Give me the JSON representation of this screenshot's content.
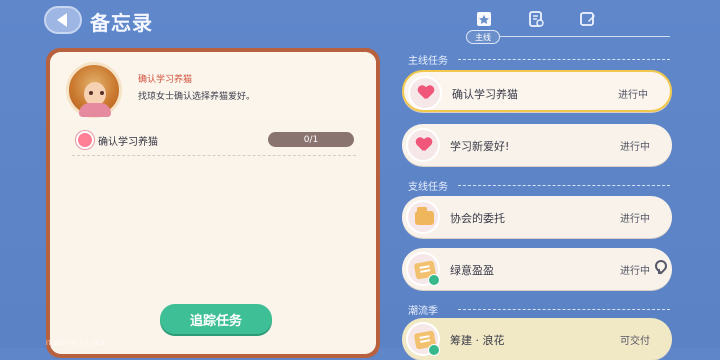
{
  "header": {
    "title": "备忘录",
    "tabs": [
      {
        "name": "main",
        "icon": "main-quest-icon"
      },
      {
        "name": "branch",
        "icon": "document-icon"
      },
      {
        "name": "edit",
        "icon": "edit-icon"
      }
    ],
    "active_tab_label": "主线"
  },
  "detail": {
    "npc_task_title": "确认学习养猫",
    "npc_task_desc": "找琼女士确认选择养猫爱好。",
    "task_label": "确认学习养猫",
    "progress_text": "0/1",
    "progress_value": 0,
    "track_button": "追踪任务",
    "debug": "IT 2022 TE 0.1.18.0"
  },
  "sections": {
    "main": "主线任务",
    "branch": "支线任务",
    "season": "潮流季"
  },
  "quests": [
    {
      "name": "确认学习养猫",
      "status": "进行中",
      "icon": "heart-icon",
      "selected": true
    },
    {
      "name": "学习新爱好!",
      "status": "进行中",
      "icon": "heart-icon",
      "selected": false
    },
    {
      "name": "协会的委托",
      "status": "进行中",
      "icon": "folder-icon",
      "selected": false
    },
    {
      "name": "绿意盈盈",
      "status": "进行中",
      "icon": "book-icon",
      "selected": false
    },
    {
      "name": "筹建 · 浪花",
      "status": "可交付",
      "icon": "book-icon",
      "selected": false
    }
  ],
  "colors": {
    "background": "#5e86c8",
    "accent_green": "#3ebf95",
    "selected_border": "#f2c84c",
    "npc_name": "#d2533e"
  }
}
